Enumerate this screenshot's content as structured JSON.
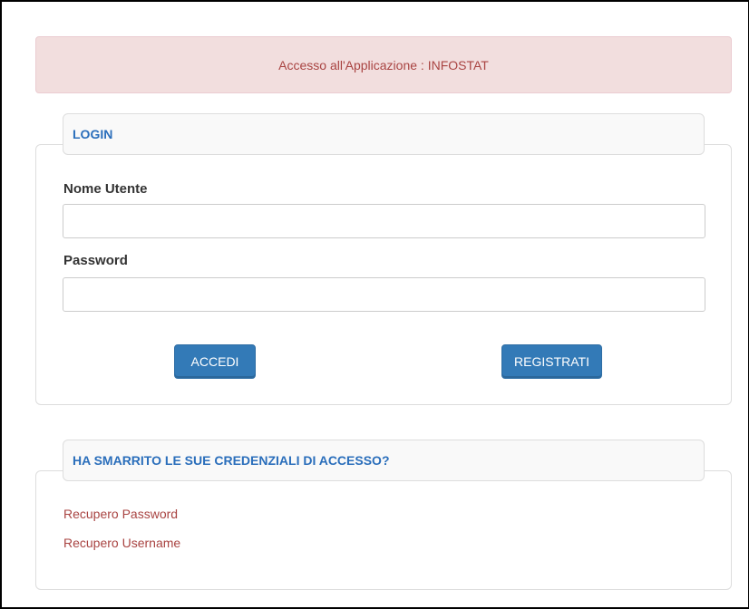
{
  "banner": {
    "text": "Accesso all'Applicazione : INFOSTAT"
  },
  "login": {
    "legend": "LOGIN",
    "username_label": "Nome Utente",
    "username_value": "",
    "password_label": "Password",
    "password_value": "",
    "accedi_label": "ACCEDI",
    "registrati_label": "REGISTRATI"
  },
  "recover": {
    "legend": "HA SMARRITO LE SUE CREDENZIALI DI ACCESSO?",
    "password_link": "Recupero Password",
    "username_link": "Recupero Username"
  },
  "colors": {
    "banner_bg": "#f2dede",
    "banner_text": "#a94442",
    "legend_text": "#2a6ebb",
    "button_bg": "#337ab7",
    "link_text": "#a94442"
  }
}
